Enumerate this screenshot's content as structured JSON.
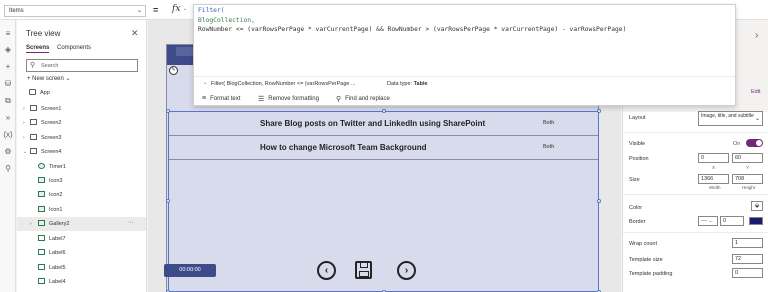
{
  "formula_bar": {
    "property": "Items",
    "equals": "=",
    "fx": "fx",
    "code_lines": [
      {
        "func": "Filter("
      },
      {
        "id": "BlogCollection,"
      },
      {
        "text": "RowNumber <= (varRowsPerPage * varCurrentPage) && RowNumber > (varRowsPerPage * varCurrentPage) - varRowsPerPage)"
      }
    ],
    "code_line1": "Filter(",
    "code_line2": "BlogCollection,",
    "code_line3": "RowNumber <= (varRowsPerPage * varCurrentPage) && RowNumber > (varRowsPerPage * varCurrentPage) - varRowsPerPage)",
    "hint": "Filter( BlogCollection, RowNumber <= (varRowsPerPage ...",
    "data_type_label": "Data type:",
    "data_type_value": "Table",
    "format_text": "Format text",
    "remove_formatting": "Remove formatting",
    "find_replace": "Find and replace"
  },
  "tree": {
    "title": "Tree view",
    "tabs": [
      "Screens",
      "Components"
    ],
    "search_placeholder": "Search",
    "new_screen": "New screen",
    "items": [
      {
        "label": "App"
      },
      {
        "label": "Screen1"
      },
      {
        "label": "Screen2"
      },
      {
        "label": "Screen3"
      },
      {
        "label": "Screen4"
      },
      {
        "label": "Timer1"
      },
      {
        "label": "Icon3"
      },
      {
        "label": "Icon2"
      },
      {
        "label": "Icon1"
      },
      {
        "label": "Gallery2"
      },
      {
        "label": "Label7"
      },
      {
        "label": "Label6"
      },
      {
        "label": "Label5"
      },
      {
        "label": "Label4"
      }
    ]
  },
  "canvas": {
    "rows": [
      {
        "title": "Share Blog posts on Twitter and LinkedIn using SharePoint",
        "tag": "Both"
      },
      {
        "title": "How to change Microsoft Team Background",
        "tag": "Both"
      }
    ],
    "timer": "00:00:00"
  },
  "properties": {
    "edit": "Edit",
    "layout_label": "Layout",
    "layout_value": "Image, title, and subtitle",
    "visible_label": "Visible",
    "visible_value": "On",
    "position_label": "Position",
    "position_x": "0",
    "position_y": "60",
    "position_x_sub": "X",
    "position_y_sub": "Y",
    "size_label": "Size",
    "size_w": "1366",
    "size_h": "708",
    "size_w_sub": "Width",
    "size_h_sub": "Height",
    "color_label": "Color",
    "border_label": "Border",
    "border_value": "0",
    "wrap_label": "Wrap count",
    "wrap_value": "1",
    "template_size_label": "Template size",
    "template_size_value": "72",
    "template_padding_label": "Template padding",
    "template_padding_value": "0"
  }
}
